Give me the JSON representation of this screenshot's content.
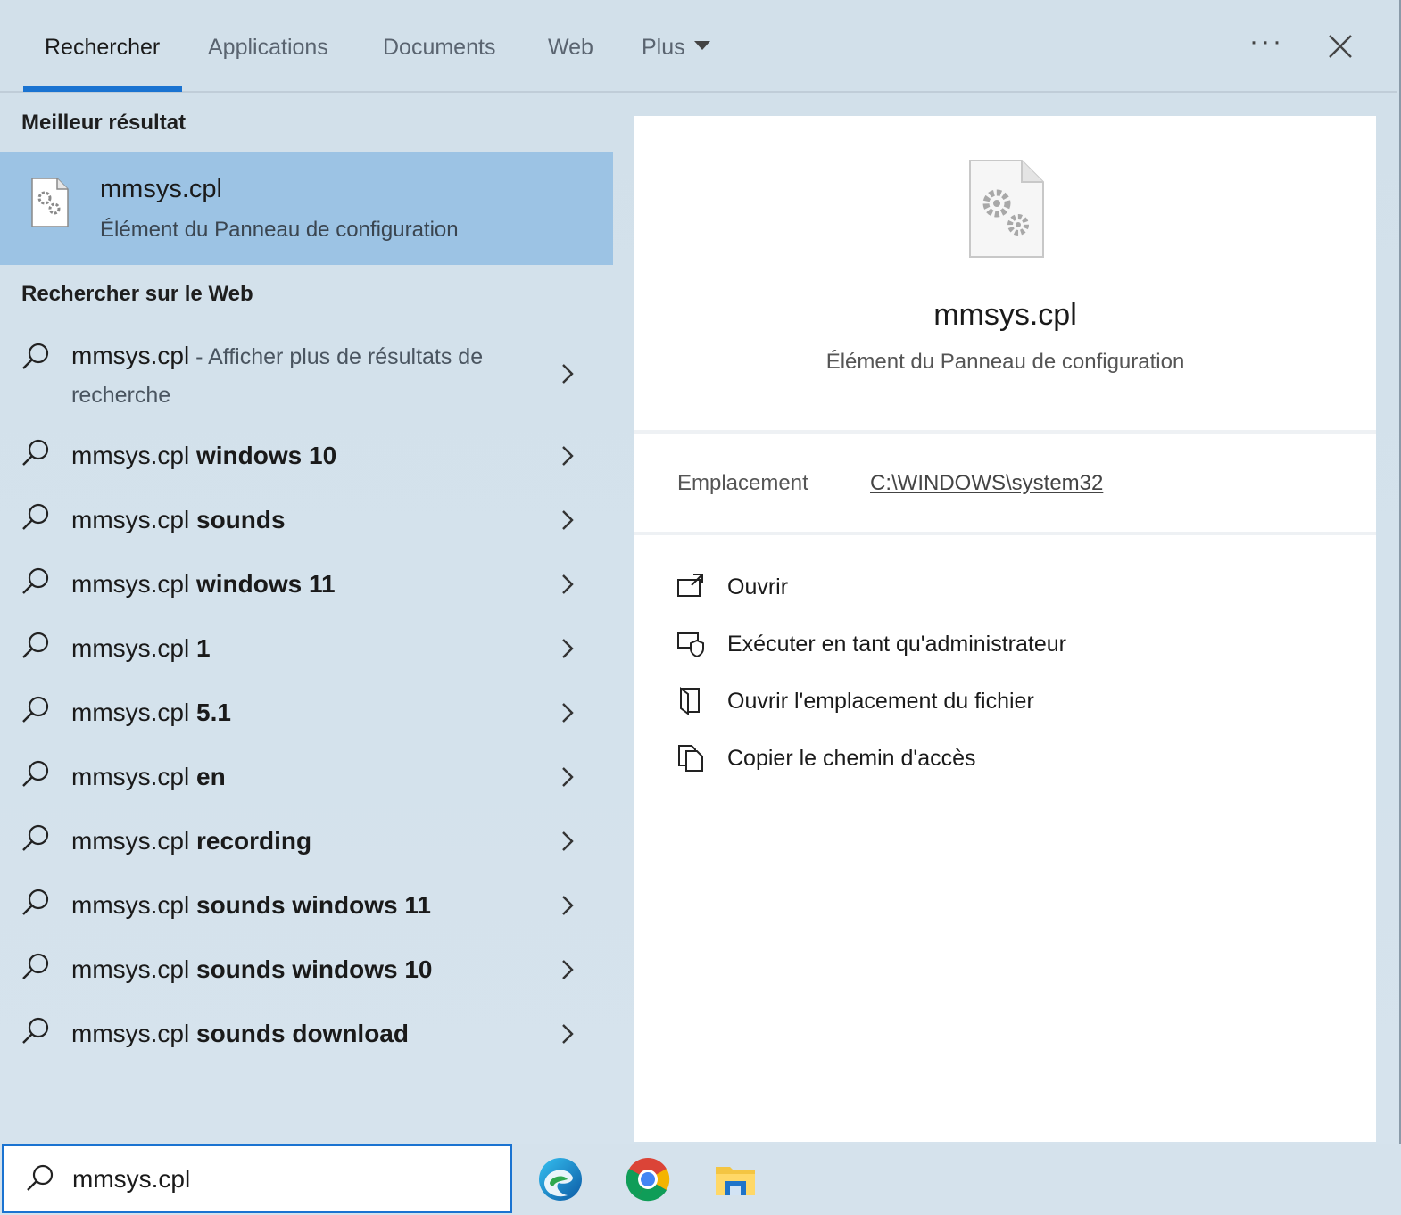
{
  "tabs": [
    {
      "label": "Rechercher"
    },
    {
      "label": "Applications"
    },
    {
      "label": "Documents"
    },
    {
      "label": "Web"
    },
    {
      "label": "Plus"
    }
  ],
  "header": {
    "more_label": "···"
  },
  "best_section": {
    "title": "Meilleur résultat",
    "name": "mmsys.cpl",
    "type": "Élément du Panneau de configuration"
  },
  "web_section": {
    "title": "Rechercher sur le Web",
    "items": [
      {
        "query": "mmsys.cpl",
        "rest": "",
        "sub": " - Afficher plus de résultats de recherche"
      },
      {
        "query": "mmsys.cpl ",
        "rest": "windows 10",
        "sub": ""
      },
      {
        "query": "mmsys.cpl ",
        "rest": "sounds",
        "sub": ""
      },
      {
        "query": "mmsys.cpl ",
        "rest": "windows 11",
        "sub": ""
      },
      {
        "query": "mmsys.cpl ",
        "rest": "1",
        "sub": ""
      },
      {
        "query": "mmsys.cpl ",
        "rest": "5.1",
        "sub": ""
      },
      {
        "query": "mmsys.cpl ",
        "rest": "en",
        "sub": ""
      },
      {
        "query": "mmsys.cpl ",
        "rest": "recording",
        "sub": ""
      },
      {
        "query": "mmsys.cpl ",
        "rest": "sounds windows 11",
        "sub": ""
      },
      {
        "query": "mmsys.cpl ",
        "rest": "sounds windows 10",
        "sub": ""
      },
      {
        "query": "mmsys.cpl ",
        "rest": "sounds download",
        "sub": ""
      }
    ]
  },
  "detail": {
    "name": "mmsys.cpl",
    "type": "Élément du Panneau de configuration",
    "location_label": "Emplacement",
    "location_value": "C:\\WINDOWS\\system32",
    "actions": [
      {
        "label": "Ouvrir",
        "icon": "open-icon"
      },
      {
        "label": "Exécuter en tant qu'administrateur",
        "icon": "run-as-admin-icon"
      },
      {
        "label": "Ouvrir l'emplacement du fichier",
        "icon": "open-file-location-icon"
      },
      {
        "label": "Copier le chemin d'accès",
        "icon": "copy-path-icon"
      }
    ]
  },
  "search": {
    "value": "mmsys.cpl"
  },
  "taskbar": {
    "apps": [
      "edge-icon",
      "chrome-icon",
      "file-explorer-icon"
    ]
  },
  "colors": {
    "accent": "#1a73d1",
    "selected": "#9cc3e4"
  }
}
